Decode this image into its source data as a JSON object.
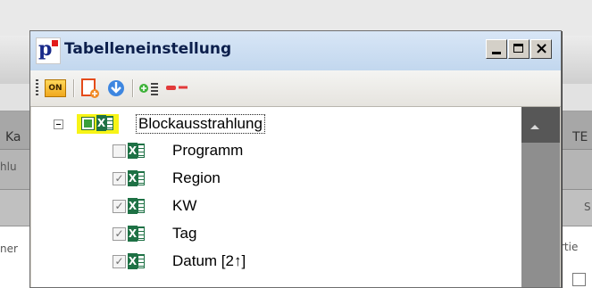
{
  "background": {
    "left_col_fragments": [
      "Ka",
      "hlu",
      "",
      "ner"
    ],
    "right_col_fragments": [
      "TE",
      "",
      "S",
      "rtie"
    ]
  },
  "dialog": {
    "title": "Tabelleneinstellung",
    "window_buttons": {
      "minimize": "_",
      "maximize": "□",
      "close": "×"
    },
    "toolbar": {
      "on_label": "ON",
      "buttons": [
        "toggle-on",
        "export-sheet",
        "download",
        "add-row",
        "remove-row"
      ]
    },
    "tree": {
      "root": {
        "label": "Blockausstrahlung",
        "expander": "−",
        "checked": "partial",
        "highlighted": true
      },
      "children": [
        {
          "label": "Programm",
          "checked": false
        },
        {
          "label": "Region",
          "checked": true
        },
        {
          "label": "KW",
          "checked": true
        },
        {
          "label": "Tag",
          "checked": true
        },
        {
          "label": "Datum  [2↑]",
          "checked": true
        }
      ]
    },
    "check_glyph": "✓"
  }
}
